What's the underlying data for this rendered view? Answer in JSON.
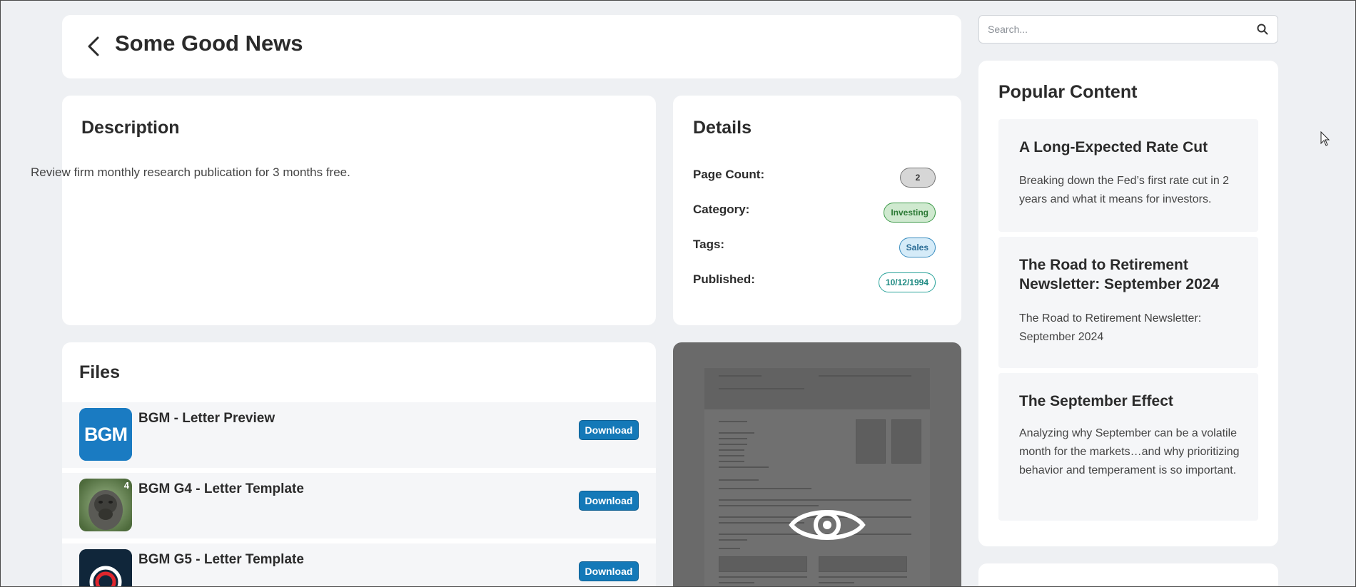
{
  "header": {
    "title": "Some Good News",
    "back_icon": "chevron-left-icon"
  },
  "description": {
    "heading": "Description",
    "text": "Review firm monthly research publication for 3 months free."
  },
  "details": {
    "heading": "Details",
    "page_count_label": "Page Count:",
    "page_count": "2",
    "category_label": "Category:",
    "category": "Investing",
    "tags_label": "Tags:",
    "tag": "Sales",
    "published_label": "Published:",
    "published": "10/12/1994"
  },
  "files": {
    "heading": "Files",
    "items": [
      {
        "title": "BGM - Letter Preview",
        "download_label": "Download",
        "thumb_text": "BGM"
      },
      {
        "title": "BGM G4 - Letter Template",
        "download_label": "Download",
        "thumb_badge": "4"
      },
      {
        "title": "BGM G5 - Letter Template",
        "download_label": "Download"
      }
    ]
  },
  "preview": {
    "icon": "eye-icon"
  },
  "search": {
    "placeholder": "Search...",
    "icon": "search-icon"
  },
  "popular": {
    "heading": "Popular Content",
    "items": [
      {
        "title": "A Long-Expected Rate Cut",
        "text": "Breaking down the Fed’s first rate cut in 2 years and what it means for investors."
      },
      {
        "title": "The Road to Retirement Newsletter: September 2024",
        "text": "The Road to Retirement Newsletter: September 2024"
      },
      {
        "title": "The September Effect",
        "text": "Analyzing why September can be a volatile month for the markets…and why prioritizing behavior and temperament is so important."
      }
    ]
  },
  "colors": {
    "background": "#eef0f3",
    "download_button": "#1479b8",
    "category_badge": "#cfe9cf",
    "tag_badge": "#d5ebf8",
    "published_badge_border": "#2aa39a"
  }
}
